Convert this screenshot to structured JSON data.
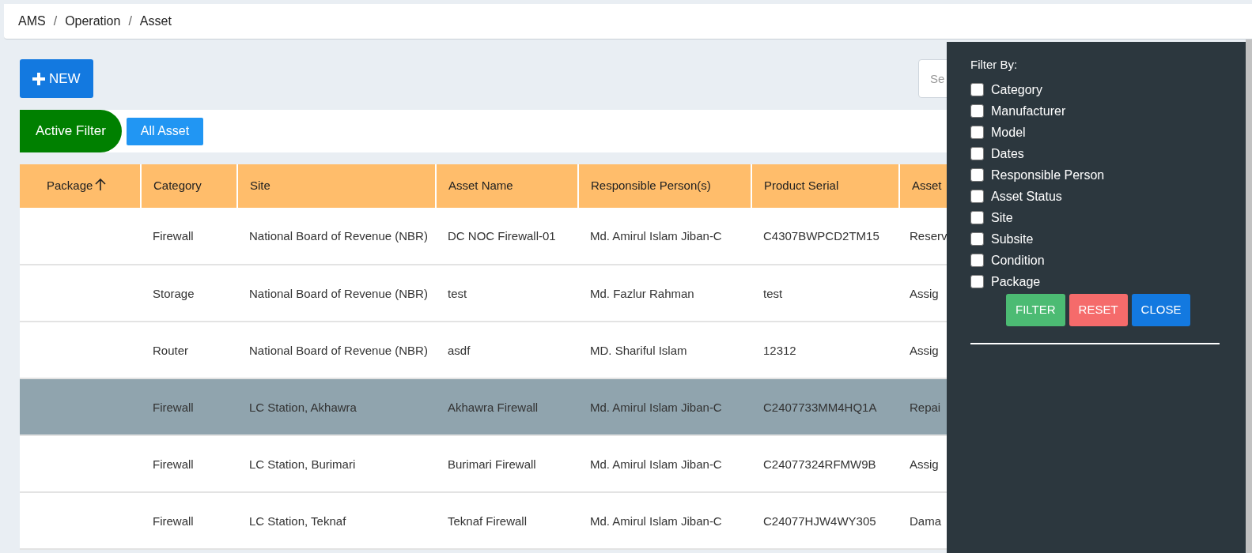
{
  "breadcrumb": [
    {
      "kind": "link",
      "text": "AMS"
    },
    {
      "kind": "separator",
      "text": "/"
    },
    {
      "kind": "link",
      "text": "Operation"
    },
    {
      "kind": "separator",
      "text": "/"
    },
    {
      "kind": "link",
      "text": "Asset"
    }
  ],
  "new_button": "NEW",
  "search": {
    "placeholder": "Se"
  },
  "filter_tabs": [
    {
      "label": "Active Filter",
      "selected": true
    },
    {
      "label": "All Asset",
      "selected": false
    }
  ],
  "table": {
    "columns": [
      {
        "label": "Package",
        "sort_ascending": true
      },
      {
        "label": "Category",
        "sort_ascending": false
      },
      {
        "label": "Site",
        "sort_ascending": false
      },
      {
        "label": "Asset Name",
        "sort_ascending": false
      },
      {
        "label": "Responsible Person(s)",
        "sort_ascending": false
      },
      {
        "label": "Product Serial",
        "sort_ascending": false
      },
      {
        "label": "Asset",
        "sort_ascending": false
      }
    ],
    "rows": [
      {
        "selected": false,
        "cells": [
          "",
          "Firewall",
          "National Board of Revenue (NBR)",
          "DC NOC Firewall-01",
          "Md. Amirul Islam Jiban-C",
          "C4307BWPCD2TM15",
          "Reserv"
        ]
      },
      {
        "selected": false,
        "cells": [
          "",
          "Storage",
          "National Board of Revenue (NBR)",
          "test",
          "Md. Fazlur Rahman",
          "test",
          "Assig"
        ]
      },
      {
        "selected": false,
        "cells": [
          "",
          "Router",
          "National Board of Revenue (NBR)",
          "asdf",
          "MD. Shariful Islam",
          "12312",
          "Assig"
        ]
      },
      {
        "selected": true,
        "cells": [
          "",
          "Firewall",
          "LC Station, Akhawra",
          "Akhawra Firewall",
          "Md. Amirul Islam Jiban-C",
          "C2407733MM4HQ1A",
          "Repai"
        ]
      },
      {
        "selected": false,
        "cells": [
          "",
          "Firewall",
          "LC Station, Burimari",
          "Burimari Firewall",
          "Md. Amirul Islam Jiban-C",
          "C24077324RFMW9B",
          "Assig"
        ]
      },
      {
        "selected": false,
        "cells": [
          "",
          "Firewall",
          "LC Station, Teknaf",
          "Teknaf Firewall",
          "Md. Amirul Islam Jiban-C",
          "C24077HJW4WY305",
          "Dama"
        ]
      }
    ]
  },
  "filter_panel": {
    "title": "Filter By:",
    "options": [
      {
        "label": "Category",
        "checked": false
      },
      {
        "label": "Manufacturer",
        "checked": false
      },
      {
        "label": "Model",
        "checked": false
      },
      {
        "label": "Dates",
        "checked": false
      },
      {
        "label": "Responsible Person",
        "checked": false
      },
      {
        "label": "Asset Status",
        "checked": false
      },
      {
        "label": "Site",
        "checked": false
      },
      {
        "label": "Subsite",
        "checked": false
      },
      {
        "label": "Condition",
        "checked": false
      },
      {
        "label": "Package",
        "checked": false
      }
    ],
    "buttons": [
      {
        "label": "FILTER",
        "kind": "filter"
      },
      {
        "label": "RESET",
        "kind": "reset"
      },
      {
        "label": "CLOSE",
        "kind": "close"
      }
    ]
  }
}
